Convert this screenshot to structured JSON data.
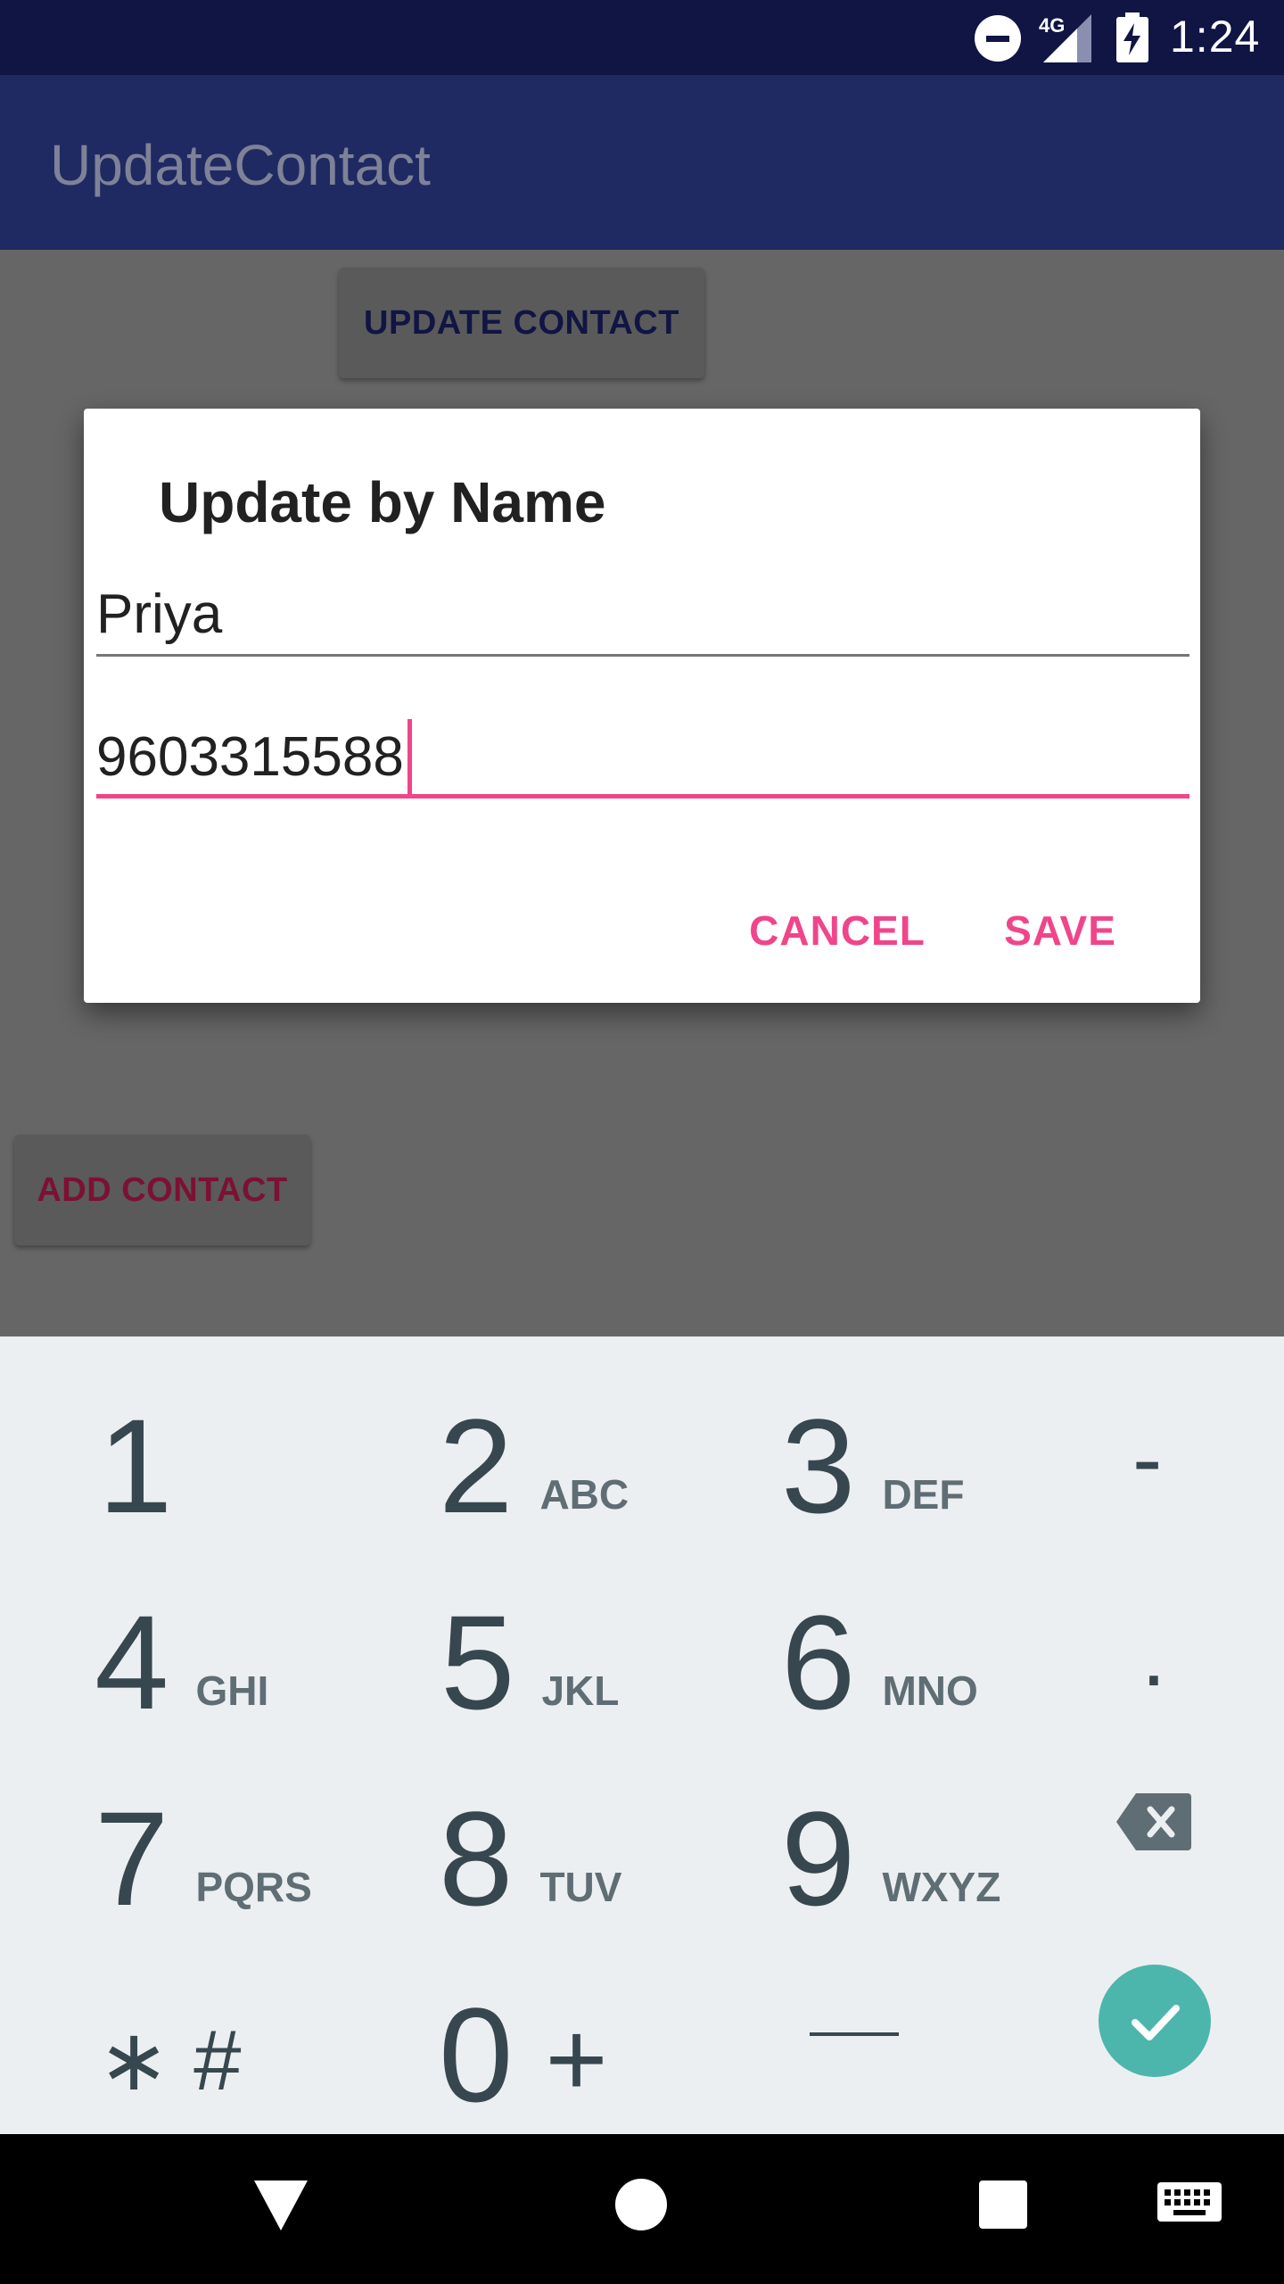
{
  "status_bar": {
    "network": "4G",
    "time": "1:24"
  },
  "app_bar": {
    "title": "UpdateContact"
  },
  "buttons": {
    "update_contact": "UPDATE CONTACT",
    "add_contact": "ADD CONTACT"
  },
  "dialog": {
    "title": "Update by Name",
    "name_value": "Priya",
    "phone_value": "9603315588",
    "cancel": "CANCEL",
    "save": "SAVE"
  },
  "keypad": {
    "keys": [
      {
        "num": "1",
        "letters": ""
      },
      {
        "num": "2",
        "letters": "ABC"
      },
      {
        "num": "3",
        "letters": "DEF"
      },
      {
        "num": "4",
        "letters": "GHI"
      },
      {
        "num": "5",
        "letters": "JKL"
      },
      {
        "num": "6",
        "letters": "MNO"
      },
      {
        "num": "7",
        "letters": "PQRS"
      },
      {
        "num": "8",
        "letters": "TUV"
      },
      {
        "num": "9",
        "letters": "WXYZ"
      },
      {
        "num": "0",
        "letters": "+"
      }
    ],
    "star_hash": "∗ #",
    "minus": "-",
    "dot": ".",
    "icons": [
      "backspace-icon",
      "check-icon"
    ],
    "accent": "#4db6ac"
  },
  "colors": {
    "primary_dark": "#101544",
    "primary": "#1f2a63",
    "accent": "#f0458a"
  }
}
